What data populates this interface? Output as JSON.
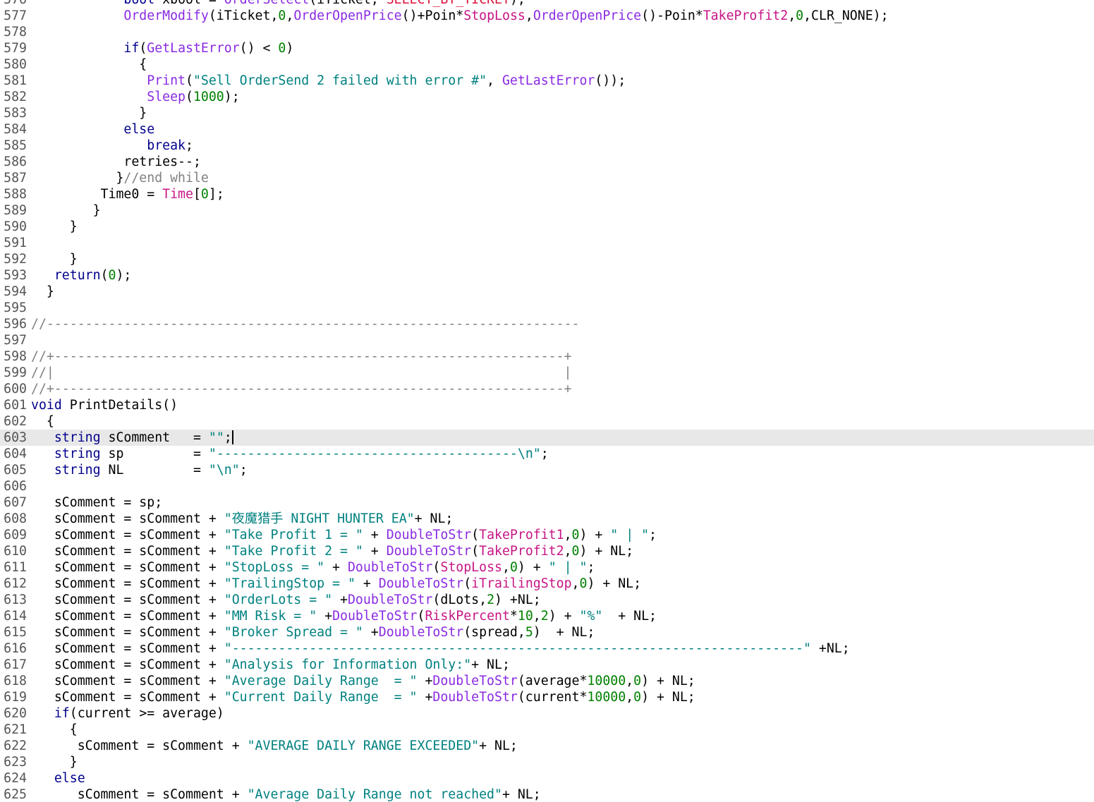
{
  "editor": {
    "caret_line": "603",
    "lines": [
      {
        "n": "576",
        "t": [
          [
            "i",
            "            "
          ],
          [
            "kw",
            "bool"
          ],
          [
            "i",
            " xbool = "
          ],
          [
            "fn",
            "OrderSelect"
          ],
          [
            "i",
            "(iTicket, "
          ],
          [
            "const",
            "SELECT_BY_TICKET"
          ],
          [
            "i",
            ");"
          ]
        ]
      },
      {
        "n": "577",
        "t": [
          [
            "i",
            "            "
          ],
          [
            "fn",
            "OrderModify"
          ],
          [
            "i",
            "(iTicket,"
          ],
          [
            "num",
            "0"
          ],
          [
            "i",
            ","
          ],
          [
            "fn",
            "OrderOpenPrice"
          ],
          [
            "i",
            "()+Poin*"
          ],
          [
            "var",
            "StopLoss"
          ],
          [
            "i",
            ","
          ],
          [
            "fn",
            "OrderOpenPrice"
          ],
          [
            "i",
            "()-Poin*"
          ],
          [
            "var",
            "TakeProfit2"
          ],
          [
            "i",
            ","
          ],
          [
            "num",
            "0"
          ],
          [
            "i",
            ",CLR_NONE);"
          ]
        ]
      },
      {
        "n": "578",
        "t": []
      },
      {
        "n": "579",
        "t": [
          [
            "i",
            "            "
          ],
          [
            "kw",
            "if"
          ],
          [
            "i",
            "("
          ],
          [
            "fn",
            "GetLastError"
          ],
          [
            "i",
            "() < "
          ],
          [
            "num",
            "0"
          ],
          [
            "i",
            ")"
          ]
        ]
      },
      {
        "n": "580",
        "t": [
          [
            "i",
            "              {"
          ]
        ]
      },
      {
        "n": "581",
        "t": [
          [
            "i",
            "               "
          ],
          [
            "fn",
            "Print"
          ],
          [
            "i",
            "("
          ],
          [
            "str",
            "\"Sell OrderSend 2 failed with error #\""
          ],
          [
            "i",
            ", "
          ],
          [
            "fn",
            "GetLastError"
          ],
          [
            "i",
            "());"
          ]
        ]
      },
      {
        "n": "582",
        "t": [
          [
            "i",
            "               "
          ],
          [
            "fn",
            "Sleep"
          ],
          [
            "i",
            "("
          ],
          [
            "num",
            "1000"
          ],
          [
            "i",
            ");"
          ]
        ]
      },
      {
        "n": "583",
        "t": [
          [
            "i",
            "              }"
          ]
        ]
      },
      {
        "n": "584",
        "t": [
          [
            "i",
            "            "
          ],
          [
            "kw",
            "else"
          ]
        ]
      },
      {
        "n": "585",
        "t": [
          [
            "i",
            "               "
          ],
          [
            "kw",
            "break"
          ],
          [
            "i",
            ";"
          ]
        ]
      },
      {
        "n": "586",
        "t": [
          [
            "i",
            "            retries--;"
          ]
        ]
      },
      {
        "n": "587",
        "t": [
          [
            "i",
            "           }"
          ],
          [
            "cmt",
            "//end while"
          ]
        ]
      },
      {
        "n": "588",
        "t": [
          [
            "i",
            "         Time0 = "
          ],
          [
            "var",
            "Time"
          ],
          [
            "i",
            "["
          ],
          [
            "num",
            "0"
          ],
          [
            "i",
            "];"
          ]
        ]
      },
      {
        "n": "589",
        "t": [
          [
            "i",
            "        }"
          ]
        ]
      },
      {
        "n": "590",
        "t": [
          [
            "i",
            "     }"
          ]
        ]
      },
      {
        "n": "591",
        "t": []
      },
      {
        "n": "592",
        "t": [
          [
            "i",
            "     }"
          ]
        ]
      },
      {
        "n": "593",
        "t": [
          [
            "i",
            "   "
          ],
          [
            "kw",
            "return"
          ],
          [
            "i",
            "("
          ],
          [
            "num",
            "0"
          ],
          [
            "i",
            ");"
          ]
        ]
      },
      {
        "n": "594",
        "t": [
          [
            "i",
            "  }"
          ]
        ]
      },
      {
        "n": "595",
        "t": []
      },
      {
        "n": "596",
        "t": [
          [
            "cmt",
            "//---------------------------------------------------------------------"
          ]
        ]
      },
      {
        "n": "597",
        "t": []
      },
      {
        "n": "598",
        "t": [
          [
            "cmt",
            "//+------------------------------------------------------------------+"
          ]
        ]
      },
      {
        "n": "599",
        "t": [
          [
            "cmt",
            "//|                                                                  |"
          ]
        ]
      },
      {
        "n": "600",
        "t": [
          [
            "cmt",
            "//+------------------------------------------------------------------+"
          ]
        ]
      },
      {
        "n": "601",
        "t": [
          [
            "kw",
            "void"
          ],
          [
            "i",
            " PrintDetails()"
          ]
        ]
      },
      {
        "n": "602",
        "t": [
          [
            "i",
            "  {"
          ]
        ]
      },
      {
        "n": "603",
        "t": [
          [
            "i",
            "   "
          ],
          [
            "kw",
            "string"
          ],
          [
            "i",
            " sComment   = "
          ],
          [
            "str",
            "\"\""
          ],
          [
            "i",
            ";"
          ]
        ]
      },
      {
        "n": "604",
        "t": [
          [
            "i",
            "   "
          ],
          [
            "kw",
            "string"
          ],
          [
            "i",
            " sp         = "
          ],
          [
            "str",
            "\"---------------------------------------\\n\""
          ],
          [
            "i",
            ";"
          ]
        ]
      },
      {
        "n": "605",
        "t": [
          [
            "i",
            "   "
          ],
          [
            "kw",
            "string"
          ],
          [
            "i",
            " NL         = "
          ],
          [
            "str",
            "\"\\n\""
          ],
          [
            "i",
            ";"
          ]
        ]
      },
      {
        "n": "606",
        "t": []
      },
      {
        "n": "607",
        "t": [
          [
            "i",
            "   sComment = sp;"
          ]
        ]
      },
      {
        "n": "608",
        "t": [
          [
            "i",
            "   sComment = sComment + "
          ],
          [
            "str",
            "\"夜魔猎手 NIGHT HUNTER EA\""
          ],
          [
            "i",
            "+ NL;"
          ]
        ]
      },
      {
        "n": "609",
        "t": [
          [
            "i",
            "   sComment = sComment + "
          ],
          [
            "str",
            "\"Take Profit 1 = \""
          ],
          [
            "i",
            " + "
          ],
          [
            "fn",
            "DoubleToStr"
          ],
          [
            "i",
            "("
          ],
          [
            "var",
            "TakeProfit1"
          ],
          [
            "i",
            ","
          ],
          [
            "num",
            "0"
          ],
          [
            "i",
            ") + "
          ],
          [
            "str",
            "\" | \""
          ],
          [
            "i",
            ";"
          ]
        ]
      },
      {
        "n": "610",
        "t": [
          [
            "i",
            "   sComment = sComment + "
          ],
          [
            "str",
            "\"Take Profit 2 = \""
          ],
          [
            "i",
            " + "
          ],
          [
            "fn",
            "DoubleToStr"
          ],
          [
            "i",
            "("
          ],
          [
            "var",
            "TakeProfit2"
          ],
          [
            "i",
            ","
          ],
          [
            "num",
            "0"
          ],
          [
            "i",
            ") + NL;"
          ]
        ]
      },
      {
        "n": "611",
        "t": [
          [
            "i",
            "   sComment = sComment + "
          ],
          [
            "str",
            "\"StopLoss = \""
          ],
          [
            "i",
            " + "
          ],
          [
            "fn",
            "DoubleToStr"
          ],
          [
            "i",
            "("
          ],
          [
            "var",
            "StopLoss"
          ],
          [
            "i",
            ","
          ],
          [
            "num",
            "0"
          ],
          [
            "i",
            ") + "
          ],
          [
            "str",
            "\" | \""
          ],
          [
            "i",
            ";"
          ]
        ]
      },
      {
        "n": "612",
        "t": [
          [
            "i",
            "   sComment = sComment + "
          ],
          [
            "str",
            "\"TrailingStop = \""
          ],
          [
            "i",
            " + "
          ],
          [
            "fn",
            "DoubleToStr"
          ],
          [
            "i",
            "("
          ],
          [
            "var",
            "iTrailingStop"
          ],
          [
            "i",
            ","
          ],
          [
            "num",
            "0"
          ],
          [
            "i",
            ") + NL;"
          ]
        ]
      },
      {
        "n": "613",
        "t": [
          [
            "i",
            "   sComment = sComment + "
          ],
          [
            "str",
            "\"OrderLots = \""
          ],
          [
            "i",
            " +"
          ],
          [
            "fn",
            "DoubleToStr"
          ],
          [
            "i",
            "(dLots,"
          ],
          [
            "num",
            "2"
          ],
          [
            "i",
            ") +NL;"
          ]
        ]
      },
      {
        "n": "614",
        "t": [
          [
            "i",
            "   sComment = sComment + "
          ],
          [
            "str",
            "\"MM Risk = \""
          ],
          [
            "i",
            " +"
          ],
          [
            "fn",
            "DoubleToStr"
          ],
          [
            "i",
            "("
          ],
          [
            "var",
            "RiskPercent"
          ],
          [
            "i",
            "*"
          ],
          [
            "num",
            "10"
          ],
          [
            "i",
            ","
          ],
          [
            "num",
            "2"
          ],
          [
            "i",
            ") + "
          ],
          [
            "str",
            "\"%\""
          ],
          [
            "i",
            "  + NL;"
          ]
        ]
      },
      {
        "n": "615",
        "t": [
          [
            "i",
            "   sComment = sComment + "
          ],
          [
            "str",
            "\"Broker Spread = \""
          ],
          [
            "i",
            " +"
          ],
          [
            "fn",
            "DoubleToStr"
          ],
          [
            "i",
            "(spread,"
          ],
          [
            "num",
            "5"
          ],
          [
            "i",
            ")  + NL;"
          ]
        ]
      },
      {
        "n": "616",
        "t": [
          [
            "i",
            "   sComment = sComment + "
          ],
          [
            "str",
            "\"--------------------------------------------------------------------------\""
          ],
          [
            "i",
            " +NL;"
          ]
        ]
      },
      {
        "n": "617",
        "t": [
          [
            "i",
            "   sComment = sComment + "
          ],
          [
            "str",
            "\"Analysis for Information Only:\""
          ],
          [
            "i",
            "+ NL;"
          ]
        ]
      },
      {
        "n": "618",
        "t": [
          [
            "i",
            "   sComment = sComment + "
          ],
          [
            "str",
            "\"Average Daily Range  = \""
          ],
          [
            "i",
            " +"
          ],
          [
            "fn",
            "DoubleToStr"
          ],
          [
            "i",
            "(average*"
          ],
          [
            "num",
            "10000"
          ],
          [
            "i",
            ","
          ],
          [
            "num",
            "0"
          ],
          [
            "i",
            ") + NL;"
          ]
        ]
      },
      {
        "n": "619",
        "t": [
          [
            "i",
            "   sComment = sComment + "
          ],
          [
            "str",
            "\"Current Daily Range  = \""
          ],
          [
            "i",
            " +"
          ],
          [
            "fn",
            "DoubleToStr"
          ],
          [
            "i",
            "(current*"
          ],
          [
            "num",
            "10000"
          ],
          [
            "i",
            ","
          ],
          [
            "num",
            "0"
          ],
          [
            "i",
            ") + NL;"
          ]
        ]
      },
      {
        "n": "620",
        "t": [
          [
            "i",
            "   "
          ],
          [
            "kw",
            "if"
          ],
          [
            "i",
            "(current >= average)"
          ]
        ]
      },
      {
        "n": "621",
        "t": [
          [
            "i",
            "     {"
          ]
        ]
      },
      {
        "n": "622",
        "t": [
          [
            "i",
            "      sComment = sComment + "
          ],
          [
            "str",
            "\"AVERAGE DAILY RANGE EXCEEDED\""
          ],
          [
            "i",
            "+ NL;"
          ]
        ]
      },
      {
        "n": "623",
        "t": [
          [
            "i",
            "     }"
          ]
        ]
      },
      {
        "n": "624",
        "t": [
          [
            "i",
            "   "
          ],
          [
            "kw",
            "else"
          ]
        ]
      },
      {
        "n": "625",
        "t": [
          [
            "i",
            "      sComment = sComment + "
          ],
          [
            "str",
            "\"Average Daily Range not reached\""
          ],
          [
            "i",
            "+ NL;"
          ]
        ]
      }
    ]
  }
}
